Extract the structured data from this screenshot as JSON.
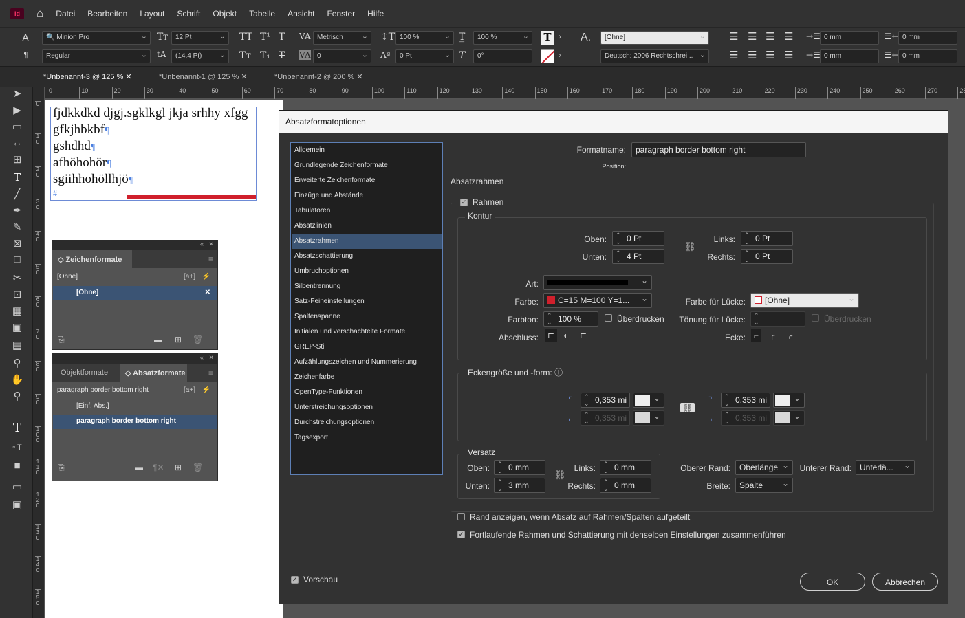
{
  "menu": {
    "logo": "Id",
    "items": [
      "Datei",
      "Bearbeiten",
      "Layout",
      "Schrift",
      "Objekt",
      "Tabelle",
      "Ansicht",
      "Fenster",
      "Hilfe"
    ]
  },
  "control": {
    "font_family": "Minion Pro",
    "font_style": "Regular",
    "font_size": "12 Pt",
    "leading": "(14,4 Pt)",
    "kerning": "Metrisch",
    "tracking": "0",
    "vscale": "100 %",
    "hscale": "100 %",
    "baseline": "0 Pt",
    "skew": "0°",
    "para_style": "[Ohne]",
    "language": "Deutsch: 2006 Rechtschrei...",
    "indent1": "0 mm",
    "indent2": "0 mm",
    "indent3": "0 mm",
    "indent4": "0 mm"
  },
  "tabs": [
    "*Unbenannt-3 @ 125 %",
    "*Unbenannt-1 @ 125 %",
    "*Unbenannt-2 @ 200 %"
  ],
  "ruler": [
    "0",
    "10",
    "20",
    "30",
    "40",
    "50",
    "60",
    "70",
    "80",
    "90",
    "100",
    "110",
    "120",
    "130",
    "140",
    "150",
    "160",
    "170",
    "180",
    "190",
    "200",
    "210",
    "220",
    "230",
    "240",
    "250",
    "260",
    "270",
    "28"
  ],
  "vruler": [
    "0",
    "1 0",
    "2 0",
    "3 0",
    "4 0",
    "5 0",
    "6 0",
    "7 0",
    "8 0",
    "9 0",
    "1 0 0",
    "1 1 0",
    "1 2 0",
    "1 3 0",
    "1 4 0",
    "1 5 0"
  ],
  "document": {
    "lines": [
      "fjdkkdkd djgj.sgklkgl jkja srhhy xfgg",
      "gfkjhbkbf",
      "gshdhd",
      "afhöhohör",
      "sgiihhohöllhjö",
      "#"
    ],
    "pilcrow": "¶"
  },
  "char_panel": {
    "tab": "Zeichenformate",
    "items": [
      "[Ohne]",
      "[Ohne]"
    ]
  },
  "para_panel": {
    "tab_inactive": "Objektformate",
    "tab_active": "Absatzformate",
    "items": [
      "paragraph border bottom right",
      "[Einf. Abs.]",
      "paragraph border bottom right"
    ]
  },
  "dialog": {
    "title": "Absatzformatoptionen",
    "nav": [
      "Allgemein",
      "Grundlegende Zeichenformate",
      "Erweiterte Zeichenformate",
      "Einzüge und Abstände",
      "Tabulatoren",
      "Absatzlinien",
      "Absatzrahmen",
      "Absatzschattierung",
      "Umbruchoptionen",
      "Silbentrennung",
      "Satz-Feineinstellungen",
      "Spaltenspanne",
      "Initialen und verschachtelte Formate",
      "GREP-Stil",
      "Aufzählungszeichen und Nummerierung",
      "Zeichenfarbe",
      "OpenType-Funktionen",
      "Unterstreichungsoptionen",
      "Durchstreichungsoptionen",
      "Tagsexport"
    ],
    "formatname_label": "Formatname:",
    "formatname": "paragraph border bottom right",
    "position_label": "Position:",
    "section": "Absatzrahmen",
    "rahmen": "Rahmen",
    "kontur": "Kontur",
    "oben_label": "Oben:",
    "oben": "0 Pt",
    "unten_label": "Unten:",
    "unten": "4 Pt",
    "links_label": "Links:",
    "links": "0 Pt",
    "rechts_label": "Rechts:",
    "rechts": "0 Pt",
    "art_label": "Art:",
    "farbe_label": "Farbe:",
    "farbe": "C=15 M=100 Y=1...",
    "farbe_luecke_label": "Farbe für Lücke:",
    "farbe_luecke": "[Ohne]",
    "farbton_label": "Farbton:",
    "farbton": "100 %",
    "ueberdrucken": "Überdrucken",
    "toenung_label": "Tönung für Lücke:",
    "ueberdrucken2": "Überdrucken",
    "abschluss_label": "Abschluss:",
    "ecke_label": "Ecke:",
    "eck_title": "Eckengröße und -form:",
    "corner_tl": "0,353 mi",
    "corner_bl": "0,353 mi",
    "corner_tr": "0,353 mi",
    "corner_br": "0,353 mi",
    "versatz": "Versatz",
    "v_oben_label": "Oben:",
    "v_oben": "0 mm",
    "v_unten_label": "Unten:",
    "v_unten": "3 mm",
    "v_links_label": "Links:",
    "v_links": "0 mm",
    "v_rechts_label": "Rechts:",
    "v_rechts": "0 mm",
    "oberer_rand_label": "Oberer Rand:",
    "oberer_rand": "Oberlänge",
    "unterer_rand_label": "Unterer Rand:",
    "unterer_rand": "Unterlä...",
    "breite_label": "Breite:",
    "breite": "Spalte",
    "rand_anzeigen": "Rand anzeigen, wenn Absatz auf Rahmen/Spalten aufgeteilt",
    "fortlaufend": "Fortlaufende Rahmen und Schattierung mit denselben Einstellungen zusammenführen",
    "vorschau": "Vorschau",
    "ok": "OK",
    "abbrechen": "Abbrechen"
  },
  "colors": {
    "accent_red": "#d0202c",
    "selection": "#3b5474",
    "frame_blue": "#6d8bd6"
  }
}
